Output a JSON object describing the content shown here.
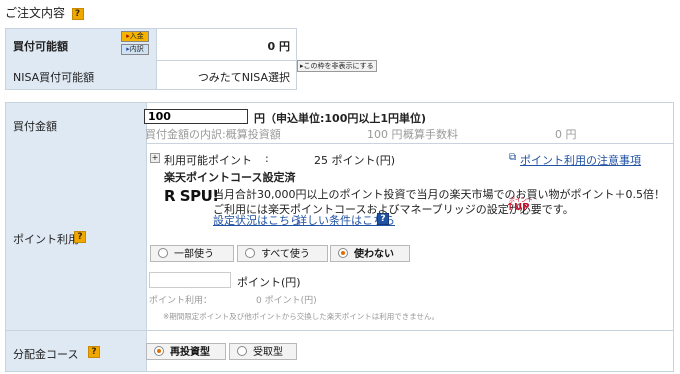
{
  "section_title": "ご注文内容",
  "help_mark": "?",
  "buying_power": {
    "label": "買付可能額",
    "deposit_btn": "入金",
    "detail_btn": "内訳",
    "value": "0 円"
  },
  "nisa_buying_power": {
    "label": "NISA買付可能額",
    "value": "つみたてNISA選択",
    "toggle_btn": "この枠を非表示にする"
  },
  "amount": {
    "label": "買付金額",
    "input_value": "100",
    "unit_note": "円（申込単位:100円以上1円単位)",
    "breakdown_label": "買付金額の内訳:概算投資額",
    "breakdown_invest": "100 円",
    "fee_label": "概算手数料",
    "fee_value": "0 円"
  },
  "points": {
    "label": "ポイント利用",
    "available_label": "利用可能ポイント",
    "colon": ":",
    "available_value": "25 ポイント(円)",
    "notes_link": "ポイント利用の注意事項",
    "course_status": "楽天ポイントコース設定済",
    "spu_logo": "R SPU!",
    "promo_line1": "当月合計30,000円以上のポイント投資で当月の楽天市場でのお買い物がポイント＋0.5倍！",
    "promo_line2": "ご利用には楽天ポイントコースおよびマネーブリッジの設定が必要です。",
    "up_top": "ポイント",
    "up_label": "UP",
    "settings_link": "設定状況はこちら",
    "conditions_link": "詳しい条件はこちら",
    "options": [
      {
        "label": "一部使う",
        "selected": false
      },
      {
        "label": "すべて使う",
        "selected": false
      },
      {
        "label": "使わない",
        "selected": true
      }
    ],
    "points_input_placeholder": "",
    "points_unit": "ポイント(円)",
    "usage_label": "ポイント利用：",
    "usage_value": "0 ポイント(円)",
    "footnote": "※期間限定ポイント及び他ポイントから交換した楽天ポイントは利用できません。"
  },
  "distribution": {
    "label": "分配金コース",
    "options": [
      {
        "label": "再投資型",
        "selected": true
      },
      {
        "label": "受取型",
        "selected": false
      }
    ]
  },
  "colors": {
    "label_bg": "#dfe9f3",
    "accent_orange": "#e07000",
    "link_blue": "#2152a3",
    "spu_red": "#c8102e"
  }
}
